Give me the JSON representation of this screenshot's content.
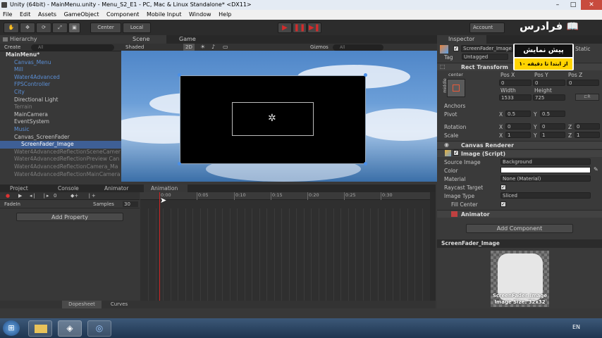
{
  "window": {
    "title": "Unity (64bit) - MainMenu.unity - Menu_S2_E1 - PC, Mac & Linux Standalone* <DX11>"
  },
  "menu": [
    "File",
    "Edit",
    "Assets",
    "GameObject",
    "Component",
    "Mobile Input",
    "Window",
    "Help"
  ],
  "toolbar": {
    "pivot": "Center",
    "space": "Local",
    "account": "Account",
    "layers": "Layers"
  },
  "hierarchy": {
    "tab": "Hierarchy",
    "create": "Create",
    "search": "All",
    "items": [
      {
        "label": "MainMenu*",
        "cls": "bold",
        "indent": 8
      },
      {
        "label": "Canvas_Menu",
        "cls": "blue",
        "indent": 20
      },
      {
        "label": "Mill",
        "cls": "blue",
        "indent": 20
      },
      {
        "label": "Water4Advanced",
        "cls": "blue",
        "indent": 20
      },
      {
        "label": "FPSController",
        "cls": "blue",
        "indent": 20
      },
      {
        "label": "City",
        "cls": "blue",
        "indent": 20
      },
      {
        "label": "Directional Light",
        "cls": "",
        "indent": 20
      },
      {
        "label": "Terrain",
        "cls": "dim",
        "indent": 20
      },
      {
        "label": "MainCamera",
        "cls": "",
        "indent": 20
      },
      {
        "label": "EventSystem",
        "cls": "",
        "indent": 20
      },
      {
        "label": "Music",
        "cls": "blue",
        "indent": 20
      },
      {
        "label": "Canvas_ScreenFader",
        "cls": "",
        "indent": 20
      },
      {
        "label": "ScreenFader_Image",
        "cls": "sel",
        "indent": 30
      },
      {
        "label": "Water4AdvancedReflectionSceneCamer",
        "cls": "dim",
        "indent": 20
      },
      {
        "label": "Water4AdvancedReflectionPreview Can",
        "cls": "dim",
        "indent": 20
      },
      {
        "label": "Water4AdvancedReflectionCamera_Ma",
        "cls": "dim",
        "indent": 20
      },
      {
        "label": "Water4AdvancedReflectionMainCamera",
        "cls": "dim",
        "indent": 20
      }
    ]
  },
  "scene": {
    "tab_scene": "Scene",
    "tab_game": "Game",
    "shading": "Shaded",
    "mode2d": "2D",
    "gizmos": "Gizmos",
    "search": "All"
  },
  "animation": {
    "tabs": [
      "Project",
      "Console",
      "Animator",
      "Animation"
    ],
    "frame": "0",
    "clip": "FadeIn",
    "samples_label": "Samples",
    "samples": "30",
    "add_property": "Add Property",
    "ticks": [
      "0:00",
      "0:05",
      "0:10",
      "0:15",
      "0:20",
      "0:25",
      "0:30"
    ],
    "footer": [
      "Dopesheet",
      "Curves"
    ]
  },
  "inspector": {
    "tab": "Inspector",
    "object_name": "ScreenFader_Image",
    "static": "Static",
    "tag_label": "Tag",
    "tag": "Untagged",
    "rect_transform": "Rect Transform",
    "anchor_mode": "center",
    "side_label": "middle",
    "pos": {
      "labels": [
        "Pos X",
        "Pos Y",
        "Pos Z"
      ],
      "values": [
        "0",
        "0",
        "0"
      ]
    },
    "size": {
      "labels": [
        "Width",
        "Height"
      ],
      "values": [
        "1533",
        "725"
      ]
    },
    "anchors": "Anchors",
    "pivot": "Pivot",
    "pivot_x": "0.5",
    "pivot_y": "0.5",
    "rotation": "Rotation",
    "rot": [
      "0",
      "0",
      "0"
    ],
    "scale": "Scale",
    "scl": [
      "1",
      "1",
      "1"
    ],
    "canvas_renderer": "Canvas Renderer",
    "image_script": "Image (Script)",
    "source_image_label": "Source Image",
    "source_image": "Background",
    "color_label": "Color",
    "material_label": "Material",
    "material": "None (Material)",
    "raycast_label": "Raycast Target",
    "image_type_label": "Image Type",
    "image_type": "Sliced",
    "fill_center_label": "Fill Center",
    "animator": "Animator",
    "add_component": "Add Component",
    "preview_title": "ScreenFader_Image",
    "preview_caption1": "ScreenFader_Image",
    "preview_caption2": "Image Size: 32x32"
  },
  "overlay": {
    "logo": "فرادرس",
    "banner_top": "پیش نمایش",
    "banner_bottom": "از ابتدا تا دقیقه ۱۰"
  },
  "taskbar": {
    "lang": "EN"
  }
}
